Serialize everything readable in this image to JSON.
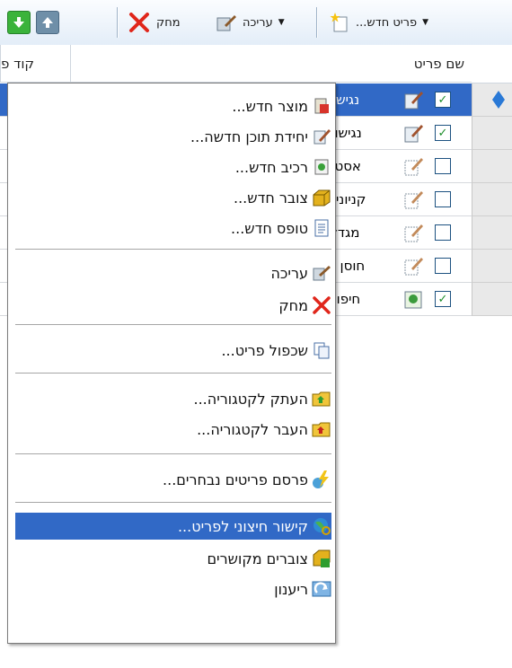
{
  "toolbar": {
    "new_item_label": "פריט חדש...",
    "edit_label": "עריכה",
    "delete_label": "מחק"
  },
  "grid": {
    "col_item_name": "שם פריט",
    "col_item_code": "קוד פ",
    "rows": [
      {
        "name": "נגישות",
        "checked": true,
        "selected": true
      },
      {
        "name": "נגישור",
        "checked": true,
        "selected": false
      },
      {
        "name": "אסטר",
        "checked": false,
        "selected": false
      },
      {
        "name": "קניונים",
        "checked": false,
        "selected": false
      },
      {
        "name": "מגדלי",
        "checked": false,
        "selected": false
      },
      {
        "name": "חוסן ס",
        "checked": false,
        "selected": false
      },
      {
        "name": "חיפוש",
        "checked": true,
        "selected": false
      }
    ]
  },
  "context_menu": {
    "new_product": "מוצר חדש...",
    "new_content_unit": "יחידת תוכן חדשה...",
    "new_component": "רכיב חדש...",
    "new_collection": "צובר חדש...",
    "new_form": "טופס חדש...",
    "edit": "עריכה",
    "delete": "מחק",
    "duplicate_item": "שכפול פריט...",
    "copy_to_category": "העתק לקטגוריה...",
    "move_to_category": "העבר לקטגוריה...",
    "publish_selected": "פרסם פריטים נבחרים...",
    "external_link": "קישור חיצוני לפריט...",
    "linked_collections": "צוברים מקושרים",
    "refresh": "ריענון"
  },
  "colors": {
    "selection": "#3169c6",
    "toolbar_bg": "#e3edf8",
    "check_green": "#1d8d2a"
  }
}
